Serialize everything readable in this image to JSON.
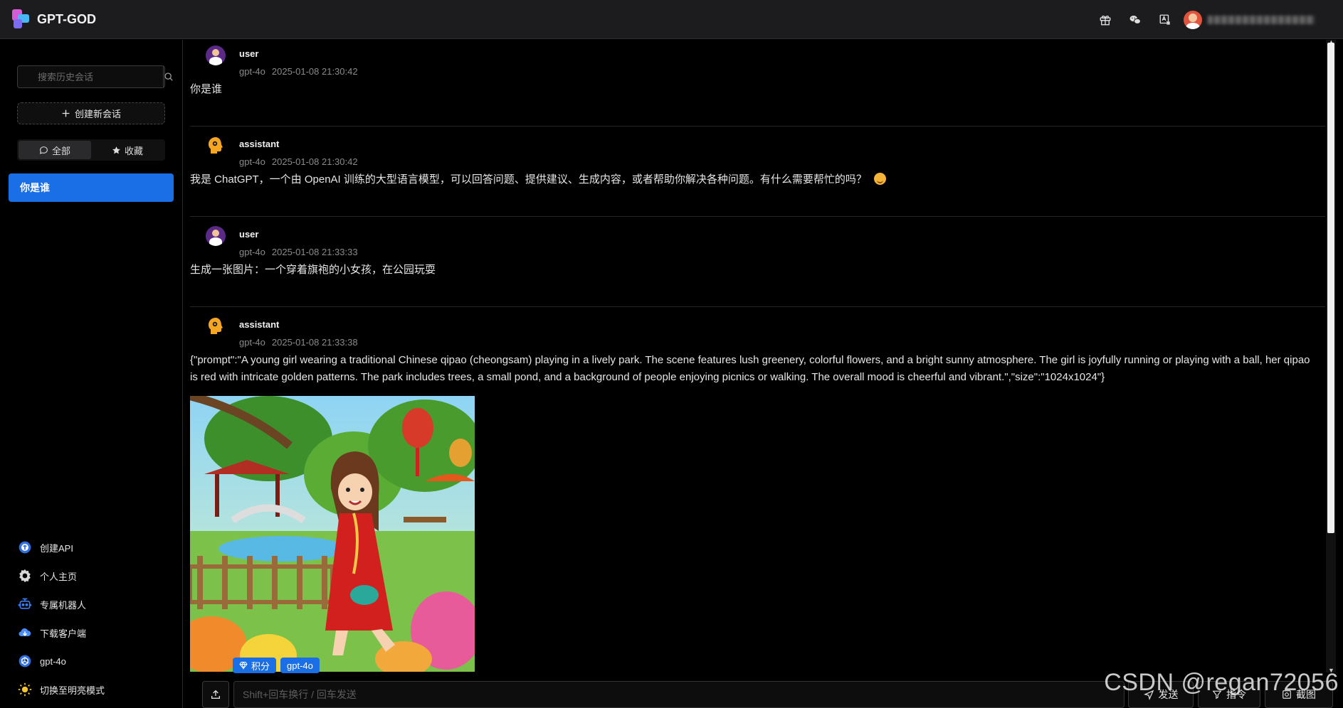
{
  "header": {
    "title": "GPT-GOD",
    "icons": [
      "gift-icon",
      "wechat-icon",
      "translate-icon"
    ],
    "user_name": ""
  },
  "sidebar": {
    "search_placeholder": "搜索历史会话",
    "new_chat_label": "创建新会话",
    "tabs": [
      {
        "label": "全部",
        "icon": "chat-bubble-icon",
        "active": true
      },
      {
        "label": "收藏",
        "icon": "star-icon",
        "active": false
      }
    ],
    "conversations": [
      {
        "title": "你是谁",
        "active": true
      }
    ],
    "menu": [
      {
        "label": "创建API",
        "icon": "api-icon"
      },
      {
        "label": "个人主页",
        "icon": "gear-icon"
      },
      {
        "label": "专属机器人",
        "icon": "robot-icon"
      },
      {
        "label": "下载客户端",
        "icon": "download-cloud-icon"
      },
      {
        "label": "gpt-4o",
        "icon": "openai-icon"
      },
      {
        "label": "切换至明亮模式",
        "icon": "sun-icon"
      }
    ]
  },
  "messages": [
    {
      "role": "user",
      "model": "gpt-4o",
      "time": "2025-01-08 21:30:42",
      "text": "你是谁"
    },
    {
      "role": "assistant",
      "model": "gpt-4o",
      "time": "2025-01-08 21:30:42",
      "text": "我是 ChatGPT，一个由 OpenAI 训练的大型语言模型，可以回答问题、提供建议、生成内容，或者帮助你解决各种问题。有什么需要帮忙的吗？"
    },
    {
      "role": "user",
      "model": "gpt-4o",
      "time": "2025-01-08 21:33:33",
      "text": "生成一张图片：一个穿着旗袍的小女孩，在公园玩耍"
    },
    {
      "role": "assistant",
      "model": "gpt-4o",
      "time": "2025-01-08 21:33:38",
      "text": "{\"prompt\":\"A young girl wearing a traditional Chinese qipao (cheongsam) playing in a lively park. The scene features lush greenery, colorful flowers, and a bright sunny atmosphere. The girl is joyfully running or playing with a ball, her qipao is red with intricate golden patterns. The park includes trees, a small pond, and a background of people enjoying picnics or walking. The overall mood is cheerful and vibrant.\",\"size\":\"1024x1024\"}"
    }
  ],
  "image_tags": [
    {
      "label": "积分",
      "icon": "diamond-icon"
    },
    {
      "label": "gpt-4o"
    }
  ],
  "composer": {
    "placeholder": "Shift+回车换行 / 回车发送",
    "send_label": "发送",
    "command_label": "指令",
    "screenshot_label": "截图"
  },
  "watermark": "CSDN @regan72056",
  "colors": {
    "accent": "#1a6ee6",
    "background": "#000000",
    "topbar": "#1c1c1e"
  }
}
